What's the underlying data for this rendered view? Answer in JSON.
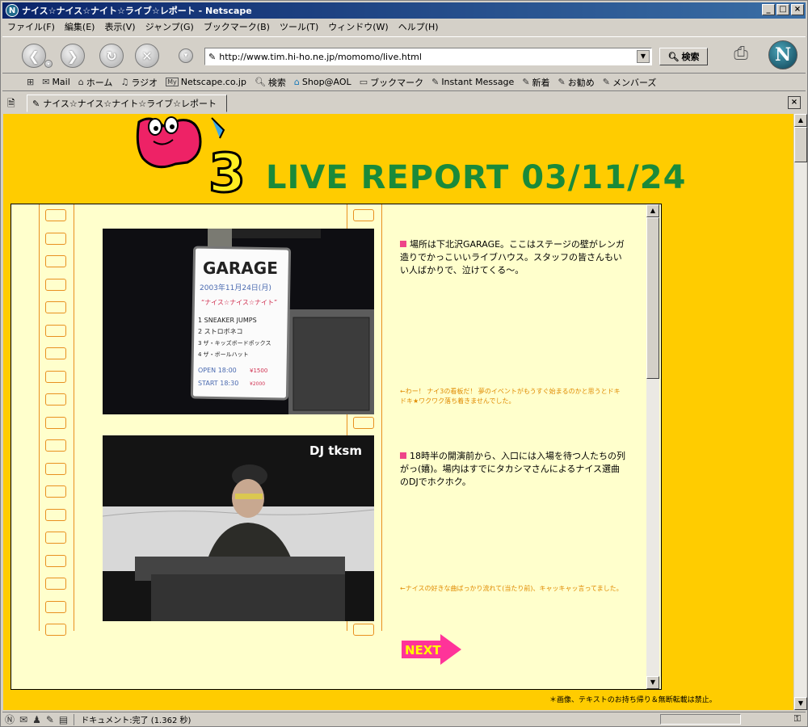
{
  "window": {
    "title": "ナイス☆ナイス☆ナイト☆ライブ☆レポート - Netscape",
    "app_icon": "N",
    "min": "_",
    "max": "□",
    "close": "×"
  },
  "menu": [
    "ファイル(F)",
    "編集(E)",
    "表示(V)",
    "ジャンプ(G)",
    "ブックマーク(B)",
    "ツール(T)",
    "ウィンドウ(W)",
    "ヘルプ(H)"
  ],
  "navbar": {
    "url": "http://www.tim.hi-ho.ne.jp/momomo/live.html",
    "search_label": "検索",
    "logo": "N"
  },
  "personal_toolbar": [
    {
      "icon": "mail-icon",
      "label": "Mail"
    },
    {
      "icon": "home-icon",
      "label": "ホーム"
    },
    {
      "icon": "radio-icon",
      "label": "ラジオ"
    },
    {
      "icon": "my-icon",
      "label": "Netscape.co.jp"
    },
    {
      "icon": "search-icon",
      "label": "検索"
    },
    {
      "icon": "shop-icon",
      "label": "Shop@AOL"
    },
    {
      "icon": "folder-icon",
      "label": "ブックマーク"
    },
    {
      "icon": "bookmark-icon",
      "label": "Instant Message"
    },
    {
      "icon": "bookmark-icon",
      "label": "新着"
    },
    {
      "icon": "bookmark-icon",
      "label": "お勧め"
    },
    {
      "icon": "bookmark-icon",
      "label": "メンバーズ"
    }
  ],
  "tab": {
    "label": "ナイス☆ナイス☆ナイト☆ライブ☆レポート",
    "close": "×"
  },
  "page": {
    "title": "LIVE REPORT  03/11/24",
    "logo_number": "3",
    "photo2_label": "DJ tksm",
    "sign": {
      "venue": "GARAGE",
      "date": "2003年11月24日(月)",
      "event": "“ナイス☆ナイス☆ナイト”",
      "lineup": [
        "1  SNEAKER JUMPS",
        "2  ストロボネコ",
        "3  ザ・キッズボードポックス",
        "4  ザ・ボールハット"
      ],
      "open": "OPEN 18:00",
      "start": "START 18:30",
      "price1": "¥1500",
      "price2": "¥2000"
    },
    "captions": [
      "場所は下北沢GARAGE。ここはステージの壁がレンガ造りでかっこいいライブハウス。スタッフの皆さんもいい人ばかりで、泣けてくる〜。",
      "18時半の開演前から、入口には入場を待つ人たちの列がっ(嬉)。場内はすでにタカシマさんによるナイス選曲のDJでホクホク。"
    ],
    "notes": [
      "←わー！ ナイ3の看板だ！ 夢のイベントがもうすぐ始まるのかと思うとドキドキ★ワクワク落ち着きませんでした。",
      "←ナイスの好きな曲ばっかり流れて(当たり前)、キャッキャッ言ってました。"
    ],
    "next_label": "NEXT",
    "copyright": "＊画像、テキストのお持ち帰り＆無断転載は禁止。"
  },
  "status": {
    "text": "ドキュメント:完了 (1.362 秒)"
  },
  "colors": {
    "page_bg": "#ffcc00",
    "panel_bg": "#ffffcc",
    "title_green": "#1a8a3a",
    "film_orange": "#e89020",
    "bullet_pink": "#ee4488",
    "next_pink": "#ff3399"
  }
}
